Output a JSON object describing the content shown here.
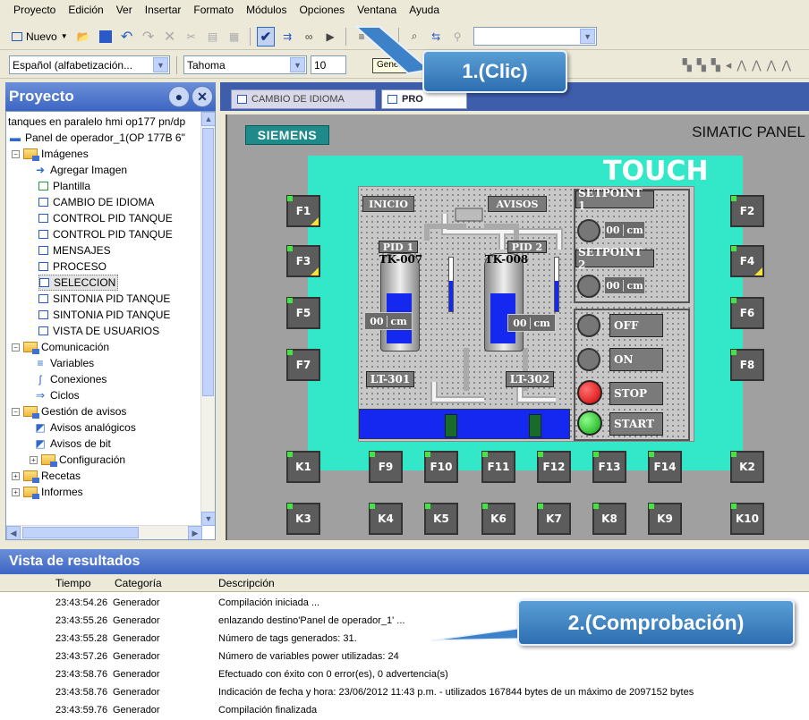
{
  "menu": [
    "Proyecto",
    "Edición",
    "Ver",
    "Insertar",
    "Formato",
    "Módulos",
    "Opciones",
    "Ventana",
    "Ayuda"
  ],
  "toolbar1": {
    "new_label": "Nuevo"
  },
  "toolbar2": {
    "language": "Español (alfabetización...",
    "font": "Tahoma",
    "font_size": "10",
    "tooltip": "Generar"
  },
  "project": {
    "title": "Proyecto",
    "tree": [
      "tanques en paralelo hmi op177 pn/dp",
      "Panel de operador_1(OP 177B 6\"",
      "Imágenes",
      "Agregar Imagen",
      "Plantilla",
      "CAMBIO DE IDIOMA",
      "CONTROL PID TANQUE",
      "CONTROL PID TANQUE",
      "MENSAJES",
      "PROCESO",
      "SELECCION",
      "SINTONIA PID TANQUE",
      "SINTONIA PID TANQUE",
      "VISTA DE USUARIOS",
      "Comunicación",
      "Variables",
      "Conexiones",
      "Ciclos",
      "Gestión de avisos",
      "Avisos analógicos",
      "Avisos de bit",
      "Configuración",
      "Recetas",
      "Informes"
    ]
  },
  "editor": {
    "tabs": [
      "CAMBIO DE IDIOMA",
      "PRO"
    ],
    "brand": "SIEMENS",
    "panel_title": "SIMATIC PANEL",
    "touch": "TOUCH",
    "fkeys_left": [
      "F1",
      "F3",
      "F5",
      "F7"
    ],
    "fkeys_right": [
      "F2",
      "F4",
      "F6",
      "F8"
    ],
    "bottom_keys": [
      "F9",
      "F10",
      "F11",
      "F12",
      "F13",
      "F14"
    ],
    "k_keys_row1": [
      "K1",
      "K2"
    ],
    "k_keys_row2": [
      "K3",
      "K4",
      "K5",
      "K6",
      "K7",
      "K8",
      "K9",
      "K10"
    ],
    "hmi": {
      "btn_inicio": "INICIO",
      "btn_avisos": "AVISOS",
      "setpoint1": "SETPOINT 1",
      "setpoint2": "SETPOINT 2",
      "sp_value": "00",
      "unit": "cm",
      "pid1": "PID 1",
      "pid2": "PID 2",
      "tank1": "TK-007",
      "tank2": "TK-008",
      "lt1": "LT-301",
      "lt2": "LT-302",
      "level_value": "00",
      "off": "OFF",
      "on": "ON",
      "stop": "STOP",
      "start": "START"
    }
  },
  "callouts": {
    "click": "1.(Clic)",
    "check": "2.(Comprobación)"
  },
  "results": {
    "title": "Vista de resultados",
    "columns": [
      "Tiempo",
      "Categoría",
      "Descripción"
    ],
    "rows": [
      [
        "23:43:54.26",
        "Generador",
        "Compilación iniciada ..."
      ],
      [
        "23:43:55.26",
        "Generador",
        "enlazando destino'Panel de operador_1' ..."
      ],
      [
        "23:43:55.28",
        "Generador",
        "Número de tags generados: 31."
      ],
      [
        "23:43:57.26",
        "Generador",
        "Número de variables power utilizadas: 24"
      ],
      [
        "23:43:58.76",
        "Generador",
        "Efectuado con éxito con 0 error(es), 0 advertencia(s)"
      ],
      [
        "23:43:58.76",
        "Generador",
        "Indicación de fecha y hora: 23/06/2012 11:43 p.m. - utilizados 167844 bytes de un máximo de 2097152 bytes"
      ],
      [
        "23:43:59.76",
        "Generador",
        "Compilación finalizada"
      ]
    ]
  }
}
